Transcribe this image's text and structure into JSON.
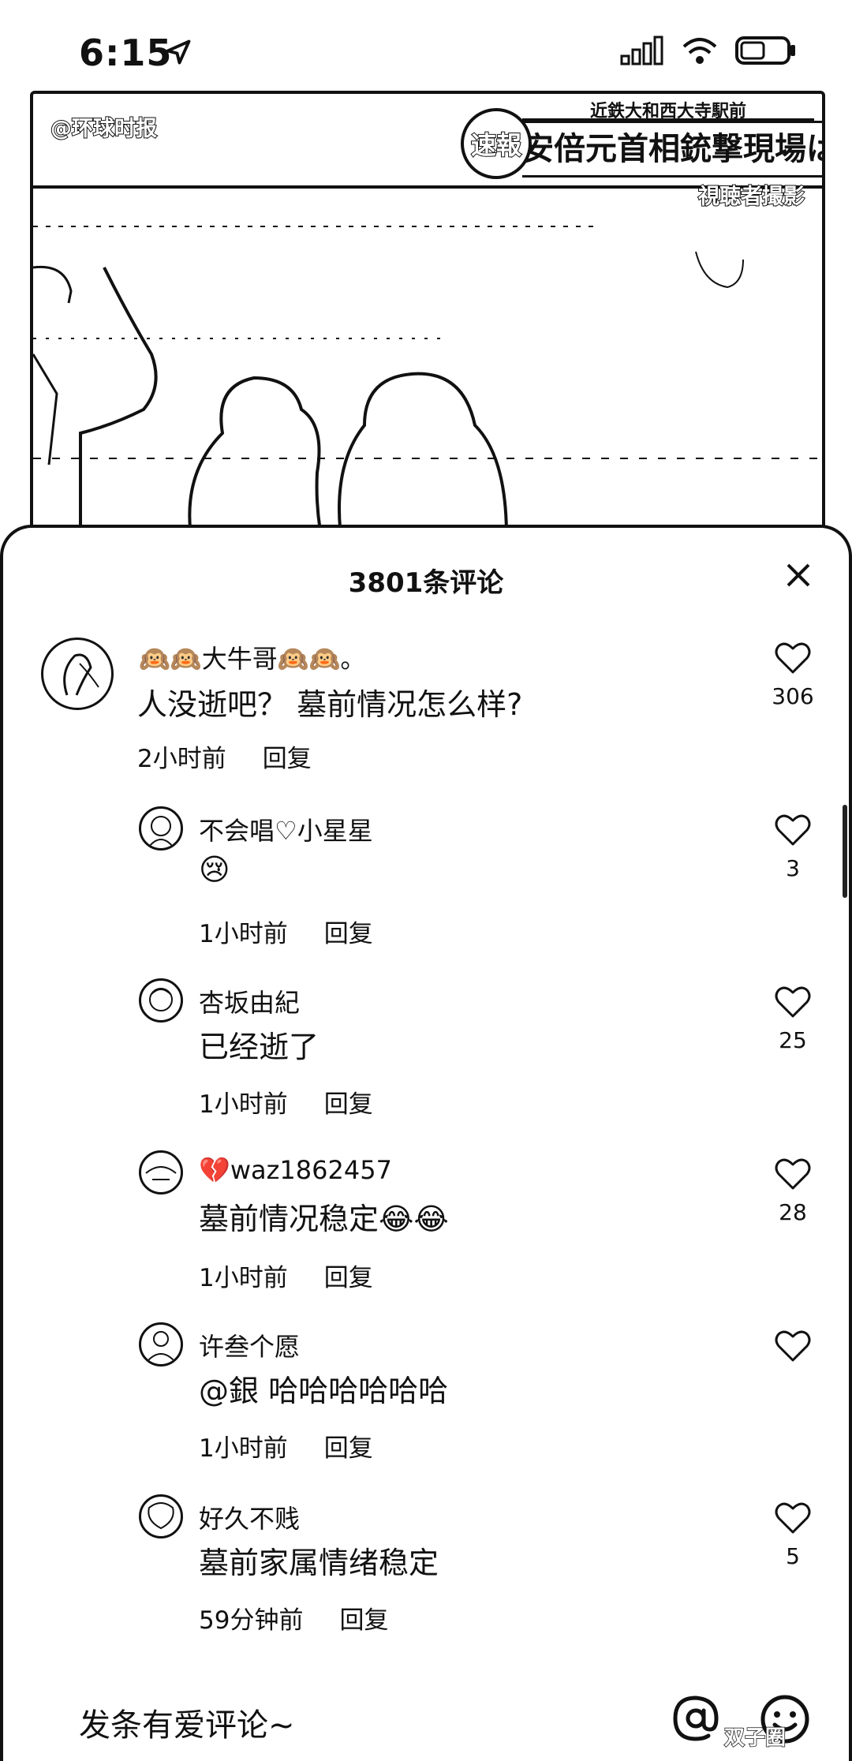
{
  "status_bar": {
    "time": "6:15",
    "icons": [
      "location-arrow-icon",
      "signal-icon",
      "wifi-icon",
      "battery-icon"
    ]
  },
  "video": {
    "watermark_handle": "@环球时报",
    "news_tag": "速報",
    "news_subline": "近鉄大和西大寺駅前",
    "news_headline": "安倍元首相銃撃現場は今",
    "news_credit": "視聴者撮影"
  },
  "comments_sheet": {
    "title": "3801条评论",
    "close_icon": "close-icon",
    "reply_label": "回复"
  },
  "comments": [
    {
      "username": "🙉🙉大牛哥🙉🙉。",
      "text": "人没逝吧？  墓前情况怎么样?",
      "time": "2小时前",
      "likes": "306"
    },
    {
      "username": "不会唱♡小星星",
      "text": "😢",
      "time": "1小时前",
      "likes": "3"
    },
    {
      "username": "杏坂由紀",
      "text": "已经逝了",
      "time": "1小时前",
      "likes": "25"
    },
    {
      "username": "💔waz1862457",
      "text": "墓前情况稳定😂😂",
      "time": "1小时前",
      "likes": "28"
    },
    {
      "username": "许叁个愿",
      "text": "@銀      哈哈哈哈哈哈",
      "time": "1小时前",
      "likes": ""
    },
    {
      "username": "好久不贱",
      "text": "墓前家属情绪稳定",
      "time": "59分钟前",
      "likes": "5"
    }
  ],
  "input_bar": {
    "placeholder": "发条有爱评论~",
    "icons": [
      "at-icon",
      "emoji-icon"
    ],
    "corner_mark": "双子圈"
  }
}
